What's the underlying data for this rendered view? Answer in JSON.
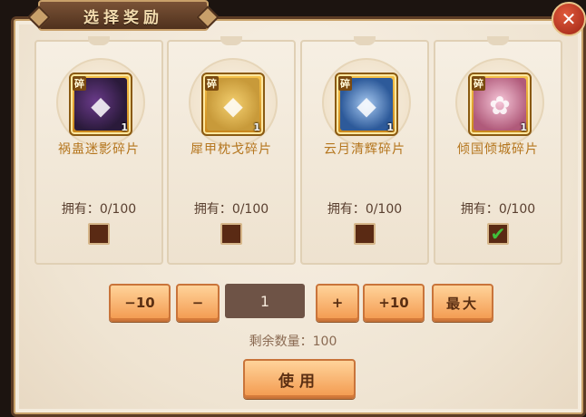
{
  "dialog": {
    "title": "选择奖励",
    "close_icon": "close-x"
  },
  "items": [
    {
      "name": "祸蛊迷影碎片",
      "frag_label": "碎",
      "count": "1",
      "owned_label": "拥有：",
      "owned_value": "0/100",
      "checked": false,
      "icon": "dark-scroll-icon",
      "glyph": "◆"
    },
    {
      "name": "犀甲枕戈碎片",
      "frag_label": "碎",
      "count": "1",
      "owned_label": "拥有：",
      "owned_value": "0/100",
      "checked": false,
      "icon": "golden-armor-icon",
      "glyph": "◆"
    },
    {
      "name": "云月清辉碎片",
      "frag_label": "碎",
      "count": "1",
      "owned_label": "拥有：",
      "owned_value": "0/100",
      "checked": false,
      "icon": "blue-scroll-icon",
      "glyph": "◆"
    },
    {
      "name": "倾国倾城碎片",
      "frag_label": "碎",
      "count": "1",
      "owned_label": "拥有：",
      "owned_value": "0/100",
      "checked": true,
      "icon": "sakura-scroll-icon",
      "glyph": "✿"
    }
  ],
  "stepper": {
    "minus10": "−10",
    "minus": "−",
    "quantity": "1",
    "plus": "+",
    "plus10": "+10",
    "max": "最大"
  },
  "remaining_label": "剩余数量：100",
  "use_button": "使用",
  "colors": {
    "accent_orange": "#f39a4f",
    "title_brown": "#4f311d",
    "item_name_gold": "#b5761e",
    "checkbox_fill": "#5a2a14",
    "check_green": "#3fbf3a"
  }
}
